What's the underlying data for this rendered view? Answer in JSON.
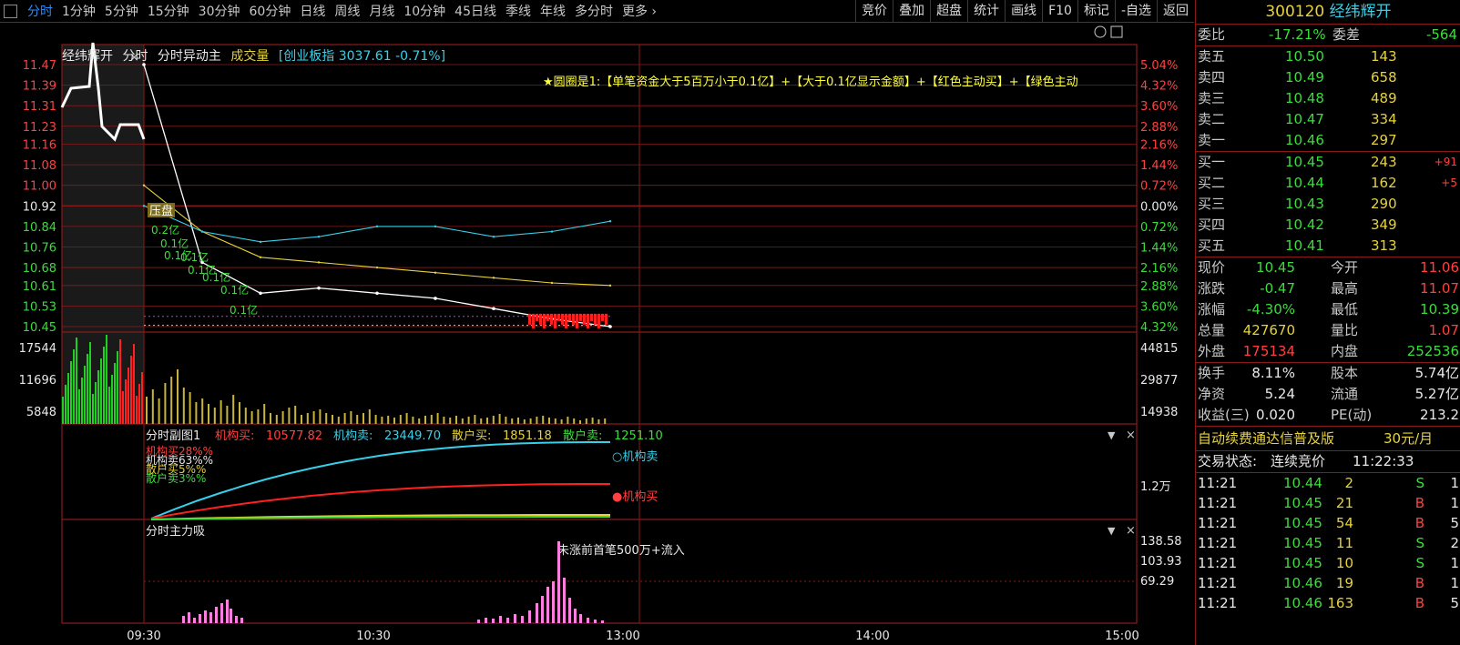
{
  "toolbar": {
    "periods": [
      "分时",
      "1分钟",
      "5分钟",
      "15分钟",
      "30分钟",
      "60分钟",
      "日线",
      "周线",
      "月线",
      "10分钟",
      "45日线",
      "季线",
      "年线",
      "多分时",
      "更多 ›"
    ],
    "right_buttons": [
      "竞价",
      "叠加",
      "超盘",
      "统计",
      "画线",
      "F10",
      "标记",
      "-自选",
      "返回"
    ]
  },
  "chart_header": {
    "stock_name": "经纬辉开",
    "tabs": [
      "分时",
      "分时异动主"
    ],
    "volume_label": "成交量",
    "index_label": "[创业板指 3037.61 -0.71%]"
  },
  "annotation_banner": "★圆圈是1:【单笔资金大于5百万小于0.1亿】+【大于0.1亿显示金额】+【红色主动买】+【绿色主动",
  "price_axis": {
    "left": [
      "11.47",
      "11.39",
      "11.31",
      "11.23",
      "11.16",
      "11.08",
      "11.00",
      "10.92",
      "10.84",
      "10.76",
      "10.68",
      "10.61",
      "10.53",
      "10.45"
    ],
    "right": [
      "5.04%",
      "4.32%",
      "3.60%",
      "2.88%",
      "2.16%",
      "1.44%",
      "0.72%",
      "0.00%",
      "0.72%",
      "1.44%",
      "2.16%",
      "2.88%",
      "3.60%",
      "4.32%"
    ]
  },
  "volume_axis": {
    "left": [
      "17544",
      "11696",
      "5848"
    ],
    "right": [
      "44815",
      "29877",
      "14938"
    ]
  },
  "sub1": {
    "title": "分时副图1",
    "items": [
      {
        "label": "机构买:",
        "value": "10577.82",
        "color": "#ff4040"
      },
      {
        "label": "机构卖:",
        "value": "23449.70",
        "color": "#38d0e8"
      },
      {
        "label": "散户买:",
        "value": "1851.18",
        "color": "#e6d23c"
      },
      {
        "label": "散户卖:",
        "value": "1251.10",
        "color": "#3cdc3c"
      }
    ],
    "pct_labels": [
      "机构买28%%",
      "机构卖63%%",
      "散户买5%%",
      "散户卖3%%"
    ],
    "line_tags": [
      "○机构卖",
      "●机构买"
    ],
    "axis_right": "1.2万"
  },
  "sub2": {
    "title": "分时主力吸",
    "note": "未涨前首笔500万+流入",
    "axis_right": [
      "138.58",
      "103.93",
      "69.29"
    ]
  },
  "markers": {
    "pressure": "压盘"
  },
  "big_order_labels": [
    "0.2亿",
    "0.1亿",
    "0.1亿",
    "0.1亿",
    "0.1亿",
    "0.1亿",
    "0.1亿",
    "0.1亿"
  ],
  "time_axis": [
    "09:30",
    "10:30",
    "13:00",
    "14:00",
    "15:00"
  ],
  "quote": {
    "code": "300120",
    "name": "经纬辉开",
    "weibi_label": "委比",
    "weibi": "-17.21%",
    "weicha_label": "委差",
    "weicha": "-564",
    "asks": [
      {
        "label": "卖五",
        "price": "10.50",
        "vol": "143"
      },
      {
        "label": "卖四",
        "price": "10.49",
        "vol": "658"
      },
      {
        "label": "卖三",
        "price": "10.48",
        "vol": "489"
      },
      {
        "label": "卖二",
        "price": "10.47",
        "vol": "334"
      },
      {
        "label": "卖一",
        "price": "10.46",
        "vol": "297"
      }
    ],
    "bids": [
      {
        "label": "买一",
        "price": "10.45",
        "vol": "243",
        "chg": "+91"
      },
      {
        "label": "买二",
        "price": "10.44",
        "vol": "162",
        "chg": "+5"
      },
      {
        "label": "买三",
        "price": "10.43",
        "vol": "290",
        "chg": ""
      },
      {
        "label": "买四",
        "price": "10.42",
        "vol": "349",
        "chg": ""
      },
      {
        "label": "买五",
        "price": "10.41",
        "vol": "313",
        "chg": ""
      }
    ],
    "stats": [
      {
        "l1": "现价",
        "v1": "10.45",
        "c1": "green",
        "l2": "今开",
        "v2": "11.06",
        "c2": "red"
      },
      {
        "l1": "涨跌",
        "v1": "-0.47",
        "c1": "green",
        "l2": "最高",
        "v2": "11.07",
        "c2": "red"
      },
      {
        "l1": "涨幅",
        "v1": "-4.30%",
        "c1": "green",
        "l2": "最低",
        "v2": "10.39",
        "c2": "green"
      },
      {
        "l1": "总量",
        "v1": "427670",
        "c1": "yellow",
        "l2": "量比",
        "v2": "1.07",
        "c2": "red"
      },
      {
        "l1": "外盘",
        "v1": "175134",
        "c1": "red",
        "l2": "内盘",
        "v2": "252536",
        "c2": "green"
      }
    ],
    "fundamentals": [
      {
        "l1": "换手",
        "v1": "8.11%",
        "l2": "股本",
        "v2": "5.74亿"
      },
      {
        "l1": "净资",
        "v1": "5.24",
        "l2": "流通",
        "v2": "5.27亿"
      },
      {
        "l1": "收益(三)",
        "v1": "0.020",
        "l2": "PE(动)",
        "v2": "213.2"
      }
    ],
    "ad_text": "自动续费通达信普及版",
    "ad_price": "30元/月",
    "trade_status_label": "交易状态:",
    "trade_status": "连续竞价",
    "trade_time": "11:22:33",
    "ticks": [
      {
        "time": "11:21",
        "price": "10.44",
        "vol": "2",
        "side": "S",
        "n": "1"
      },
      {
        "time": "11:21",
        "price": "10.45",
        "vol": "21",
        "side": "B",
        "n": "1"
      },
      {
        "time": "11:21",
        "price": "10.45",
        "vol": "54",
        "side": "B",
        "n": "5"
      },
      {
        "time": "11:21",
        "price": "10.45",
        "vol": "11",
        "side": "S",
        "n": "2"
      },
      {
        "time": "11:21",
        "price": "10.45",
        "vol": "10",
        "side": "S",
        "n": "1"
      },
      {
        "time": "11:21",
        "price": "10.46",
        "vol": "19",
        "side": "B",
        "n": "1"
      },
      {
        "time": "11:21",
        "price": "10.46",
        "vol": "163",
        "side": "B",
        "n": "5"
      }
    ]
  },
  "chart_data": {
    "type": "line",
    "prev_close": 10.92,
    "ylim": [
      10.45,
      11.47
    ],
    "x": [
      "09:30",
      "09:45",
      "10:00",
      "10:15",
      "10:30",
      "10:45",
      "11:00",
      "11:15",
      "11:22"
    ],
    "series": [
      {
        "values": [
          11.47,
          10.7,
          10.58,
          10.6,
          10.58,
          10.56,
          10.52,
          10.48,
          10.45
        ]
      },
      {
        "values": [
          11.0,
          10.82,
          10.72,
          10.7,
          10.68,
          10.66,
          10.64,
          10.62,
          10.61
        ]
      },
      {
        "values": [
          10.92,
          10.82,
          10.78,
          10.8,
          10.84,
          10.84,
          10.8,
          10.82,
          10.86
        ]
      }
    ],
    "colors": {
      "price": "#ffffff",
      "avg": "#e6d23c",
      "index": "#38d0e8",
      "up": "#ff2020",
      "down": "#20d020",
      "grid": "#8a1a1a"
    }
  }
}
